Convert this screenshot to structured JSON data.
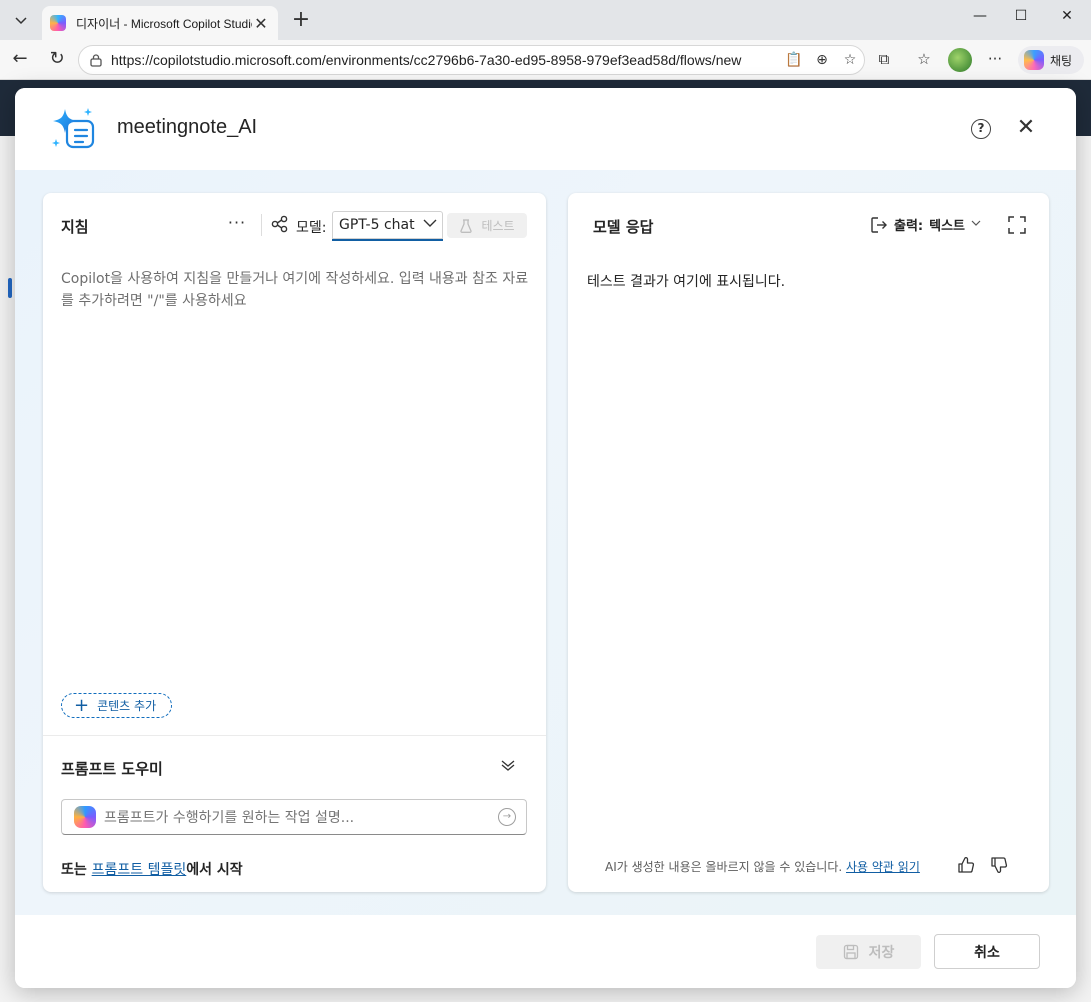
{
  "browser": {
    "tab_title": "디자이너 - Microsoft Copilot Studio",
    "url": "https://copilotstudio.microsoft.com/environments/cc2796b6-7a30-ed95-8958-979ef3ead58d/flows/new",
    "copilot_label": "채팅"
  },
  "modal": {
    "title": "meetingnote_AI",
    "instructions": {
      "heading": "지침",
      "more_label": "···",
      "model_label": "모델:",
      "model_value": "GPT-5 chat",
      "test_label": "테스트",
      "placeholder": "Copilot을 사용하여 지침을 만들거나 여기에 작성하세요. 입력 내용과 참조 자료를 추가하려면 \"/\"를 사용하세요",
      "add_content_label": "콘텐츠 추가"
    },
    "prompt_helper": {
      "heading": "프롬프트 도우미",
      "input_placeholder": "프롬프트가 수행하기를 원하는 작업 설명...",
      "template_prefix": "또는 ",
      "template_link": "프롬프트 템플릿",
      "template_suffix": "에서 시작"
    },
    "response": {
      "heading": "모델 응답",
      "output_label": "출력:",
      "output_value": "텍스트",
      "placeholder": "테스트 결과가 여기에 표시됩니다.",
      "disclaimer": "AI가 생성한 내용은 올바르지 않을 수 있습니다.",
      "terms_link": "사용 약관 읽기"
    },
    "footer": {
      "save_label": "저장",
      "cancel_label": "취소"
    }
  },
  "colors": {
    "accent": "#115ea3",
    "modal_body_bg": "#eaf3fb",
    "page_header": "#1f2b3a"
  }
}
